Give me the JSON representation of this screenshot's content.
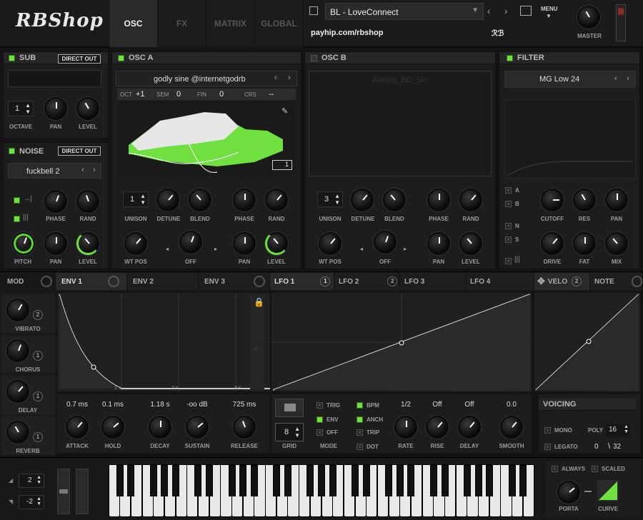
{
  "top": {
    "logo": "RBShop",
    "tabs": [
      "OSC",
      "FX",
      "MATRIX",
      "GLOBAL"
    ],
    "preset": "BL - LoveConnect",
    "url": "payhip.com/rbshop",
    "author": "ℛℬ",
    "menu": "MENU",
    "master": "MASTER"
  },
  "sub": {
    "title": "SUB",
    "direct": "DIRECT OUT",
    "octave": "1",
    "l_octave": "OCTAVE",
    "l_pan": "PAN",
    "l_level": "LEVEL"
  },
  "noise": {
    "title": "NOISE",
    "direct": "DIRECT OUT",
    "preset": "fuckbell 2",
    "l_phase": "PHASE",
    "l_rand": "RAND",
    "l_pitch": "PITCH",
    "l_pan": "PAN",
    "l_level": "LEVEL"
  },
  "oscA": {
    "title": "OSC A",
    "wavetable": "godly sine @internetgodrb",
    "oct_l": "OCT",
    "oct": "+1",
    "sem_l": "SEM",
    "sem": "0",
    "fin_l": "FIN",
    "fin": "0",
    "crs_l": "CRS",
    "crs": "--",
    "frame": "1",
    "unison": "1",
    "l_unison": "UNISON",
    "l_detune": "DETUNE",
    "l_blend": "BLEND",
    "l_phase": "PHASE",
    "l_rand": "RAND",
    "l_wtpos": "WT POS",
    "warp": "OFF",
    "l_pan": "PAN",
    "l_level": "LEVEL"
  },
  "oscB": {
    "title": "OSC B",
    "wavetable": "Analog_BD_Sin",
    "unison": "3",
    "l_unison": "UNISON",
    "l_detune": "DETUNE",
    "l_blend": "BLEND",
    "l_phase": "PHASE",
    "l_rand": "RAND",
    "l_wtpos": "WT POS",
    "warp": "OFF",
    "l_pan": "PAN",
    "l_level": "LEVEL"
  },
  "filter": {
    "title": "FILTER",
    "type": "MG Low 24",
    "a": "A",
    "b": "B",
    "n": "N",
    "s": "S",
    "l_cutoff": "CUTOFF",
    "l_res": "RES",
    "l_pan": "PAN",
    "l_drive": "DRIVE",
    "l_fat": "FAT",
    "l_mix": "MIX"
  },
  "mod": {
    "mod": "MOD",
    "env1": "ENV 1",
    "env2": "ENV 2",
    "env3": "ENV 3",
    "lfo1": "LFO 1",
    "lfo1n": "1",
    "lfo2": "LFO 2",
    "lfo2n": "2",
    "lfo3": "LFO 3",
    "lfo4": "LFO 4",
    "velo": "VELO",
    "velon": "2",
    "note": "NOTE"
  },
  "fxside": [
    {
      "label": "VIBRATO",
      "n": "2"
    },
    {
      "label": "CHORUS",
      "n": "1"
    },
    {
      "label": "DELAY",
      "n": "1"
    },
    {
      "label": "REVERB",
      "n": "1"
    }
  ],
  "env": {
    "ticks": [
      "1 s",
      "2 s",
      "3 s"
    ],
    "attack": "0.7 ms",
    "hold": "0.1 ms",
    "decay": "1.18 s",
    "sustain": "-oo dB",
    "release": "725 ms",
    "l_attack": "ATTACK",
    "l_hold": "HOLD",
    "l_decay": "DECAY",
    "l_sustain": "SUSTAIN",
    "l_release": "RELEASE"
  },
  "lfo": {
    "grid": "8",
    "l_grid": "GRID",
    "trig": "TRIG",
    "envm": "ENV",
    "off": "OFF",
    "l_mode": "MODE",
    "bpm": "BPM",
    "anch": "ANCH",
    "trip": "TRIP",
    "dot": "DOT",
    "rate": "1/2",
    "rise": "Off",
    "delay": "Off",
    "smooth": "0.0",
    "l_rate": "RATE",
    "l_rise": "RISE",
    "l_delay": "DELAY",
    "l_smooth": "SMOOTH"
  },
  "voicing": {
    "title": "VOICING",
    "mono": "MONO",
    "poly_l": "POLY",
    "poly": "16",
    "legato": "LEGATO",
    "count": "0",
    "max": "32"
  },
  "bottom": {
    "pb_up": "2",
    "pb_down": "-2",
    "always": "ALWAYS",
    "scaled": "SCALED",
    "porta": "PORTA",
    "curve": "CURVE"
  }
}
